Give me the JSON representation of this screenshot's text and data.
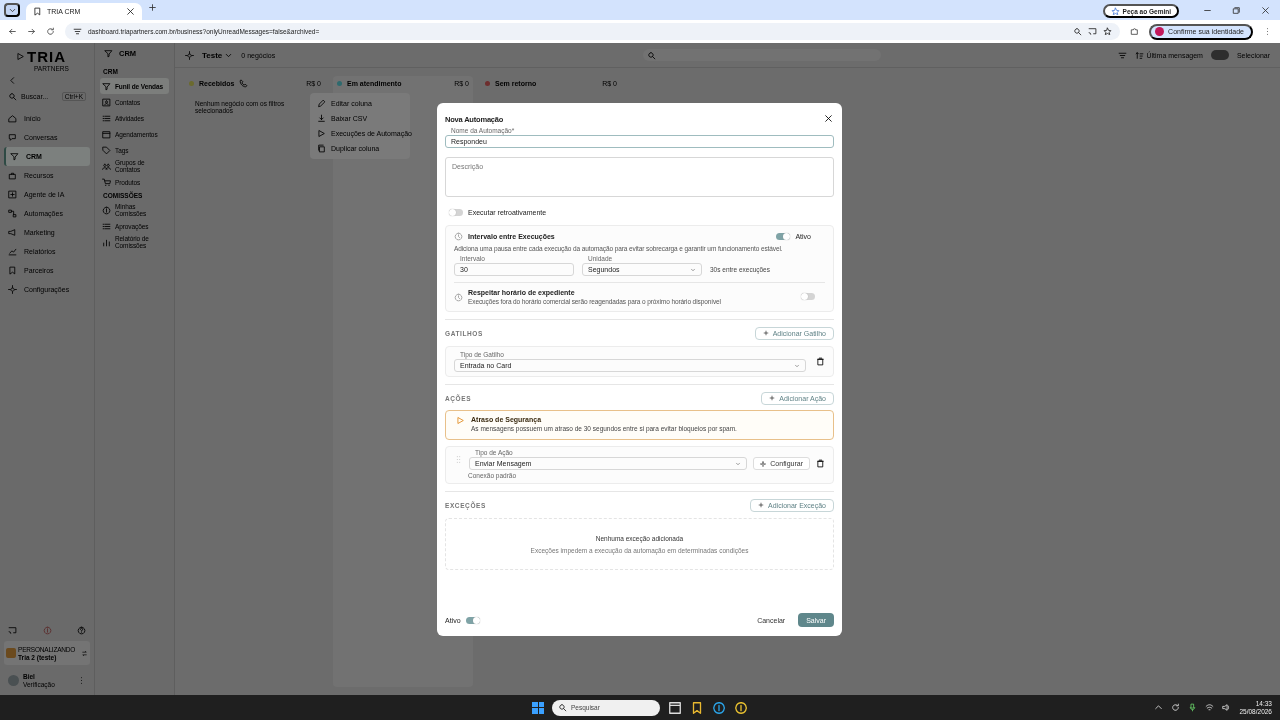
{
  "browser": {
    "tab_title": "TRIA CRM",
    "url": "dashboard.triapartners.com.br/business?onlyUnreadMessages=false&archived=",
    "gemini": "Peça ao Gemini",
    "profile": "Confirme sua identidade"
  },
  "sidebar": {
    "brand": "TRIA",
    "tagline": "PARTNERS",
    "search_placeholder": "Buscar...",
    "shortcut": "Ctrl+K",
    "items": [
      {
        "label": "Início",
        "selected": false
      },
      {
        "label": "Conversas",
        "selected": false
      },
      {
        "label": "CRM",
        "selected": true
      },
      {
        "label": "Recursos",
        "selected": false
      },
      {
        "label": "Agente de IA",
        "selected": false
      },
      {
        "label": "Automações",
        "selected": false
      },
      {
        "label": "Marketing",
        "selected": false
      },
      {
        "label": "Relatórios",
        "selected": false
      },
      {
        "label": "Parceiros",
        "selected": false
      },
      {
        "label": "Configurações",
        "selected": false
      }
    ],
    "org": {
      "label": "PERSONALIZANDO",
      "name": "Tria 2 (teste)"
    },
    "user": {
      "name": "Biel",
      "subtitle": "Verificação"
    }
  },
  "subnav": {
    "title": "CRM",
    "sections": [
      {
        "heading": "CRM",
        "items": [
          {
            "label": "Funil de Vendas",
            "selected": true
          },
          {
            "label": "Contatos",
            "selected": false
          },
          {
            "label": "Atividades",
            "selected": false
          },
          {
            "label": "Agendamentos",
            "selected": false
          },
          {
            "label": "Tags",
            "selected": false
          },
          {
            "label": "Grupos de Contatos",
            "selected": false
          },
          {
            "label": "Produtos",
            "selected": false
          }
        ]
      },
      {
        "heading": "COMISSÕES",
        "items": [
          {
            "label": "Minhas Comissões",
            "selected": false
          },
          {
            "label": "Aprovações",
            "selected": false
          },
          {
            "label": "Relatório de Comissões",
            "selected": false
          }
        ]
      }
    ]
  },
  "board": {
    "pipeline": "Teste",
    "count": "0 negócios",
    "sort": "Última mensagem",
    "select": "Selecionar",
    "columns": [
      {
        "name": "Recebidos",
        "color": "#6b6a2e",
        "total": "R$ 0",
        "empty": "Nenhum negócio com os filtros selecionados"
      },
      {
        "name": "Em atendimento",
        "color": "#2e6a6e",
        "total": "R$ 0"
      },
      {
        "name": "Sem retorno",
        "color": "#6e2e2e",
        "total": "R$ 0"
      }
    ],
    "menu": [
      "Editar coluna",
      "Baixar CSV",
      "Execuções de Automação",
      "Duplicar coluna"
    ]
  },
  "modal": {
    "title": "Nova Automação",
    "name_field": {
      "label": "Nome da Automação*",
      "value": "Respondeu"
    },
    "description": {
      "placeholder": "Descrição"
    },
    "retro": {
      "label": "Executar retroativamente",
      "on": false
    },
    "interval": {
      "title": "Intervalo entre Execuções",
      "on": true,
      "status": "Ativo",
      "description": "Adiciona uma pausa entre cada execução da automação para evitar sobrecarga e garantir um funcionamento estável.",
      "interval_label": "Intervalo",
      "value": "30",
      "unit_label": "Unidade",
      "unit": "Segundos",
      "summary": "30s entre execuções"
    },
    "business_hours": {
      "title": "Respeitar horário de expediente",
      "description": "Execuções fora do horário comercial serão reagendadas para o próximo horário disponível",
      "on": false
    },
    "triggers": {
      "heading": "GATILHOS",
      "add": "Adicionar Gatilho",
      "items": [
        {
          "label": "Tipo de Gatilho",
          "value": "Entrada no Card"
        }
      ]
    },
    "actions": {
      "heading": "AÇÕES",
      "add": "Adicionar Ação",
      "warning": {
        "title": "Atraso de Segurança",
        "text": "As mensagens possuem um atraso de 30 segundos entre si para evitar bloqueios por spam."
      },
      "items": [
        {
          "label": "Tipo de Ação",
          "value": "Enviar Mensagem",
          "configure": "Configurar",
          "connection": "Conexão padrão"
        }
      ]
    },
    "exceptions": {
      "heading": "EXCEÇÕES",
      "add": "Adicionar Exceção",
      "empty_title": "Nenhuma exceção adicionada",
      "empty_text": "Exceções impedem a execução da automação em determinadas condições"
    },
    "footer": {
      "active_label": "Ativo",
      "on": true,
      "cancel": "Cancelar",
      "save": "Salvar"
    }
  },
  "taskbar": {
    "search": "Pesquisar",
    "time": "14:33",
    "date": "25/08/2026"
  }
}
